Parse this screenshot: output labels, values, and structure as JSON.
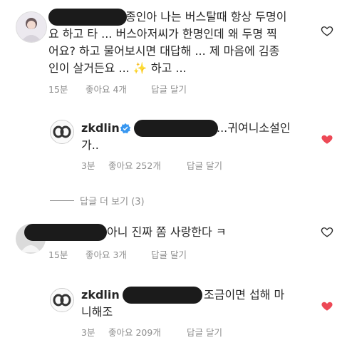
{
  "comments": [
    {
      "text_line1": "종인아 나는 버스탈때 항상 두명이",
      "text_line2": "요 하고 타 ... 버스아저씨가 한명인데 왜 두명 찍",
      "text_line3": "어요? 하고 물어보시면 대답해 ... 제 마음에 김종",
      "text_line4": "인이 살거든요 ... ✨ 하고 ...",
      "time": "15분",
      "likes": "좋아요 4개",
      "reply": "답글 달기",
      "liked": false,
      "reply_item": {
        "username": "zkdlin",
        "verified_icon": "verified-badge-icon",
        "text_line1": "...귀여니소설인",
        "text_line2": "가..",
        "time": "3분",
        "likes": "좋아요 252개",
        "reply": "답글 달기",
        "liked": true
      },
      "more_replies": "답글 더 보기 (3)"
    },
    {
      "text_line1": "아니 진짜 쫌 사랑한다 ㅋ",
      "time": "15분",
      "likes": "좋아요 3개",
      "reply": "답글 달기",
      "liked": false,
      "reply_item": {
        "username": "zkdlin",
        "text_line1": "조금이면 섭해 마",
        "text_line2": "니해조",
        "time": "3분",
        "likes": "좋아요 209개",
        "reply": "답글 달기",
        "liked": true
      }
    }
  ],
  "colors": {
    "heart_red": "#ed4956",
    "verified_blue": "#3897f0",
    "meta_gray": "#8e8e8e"
  }
}
